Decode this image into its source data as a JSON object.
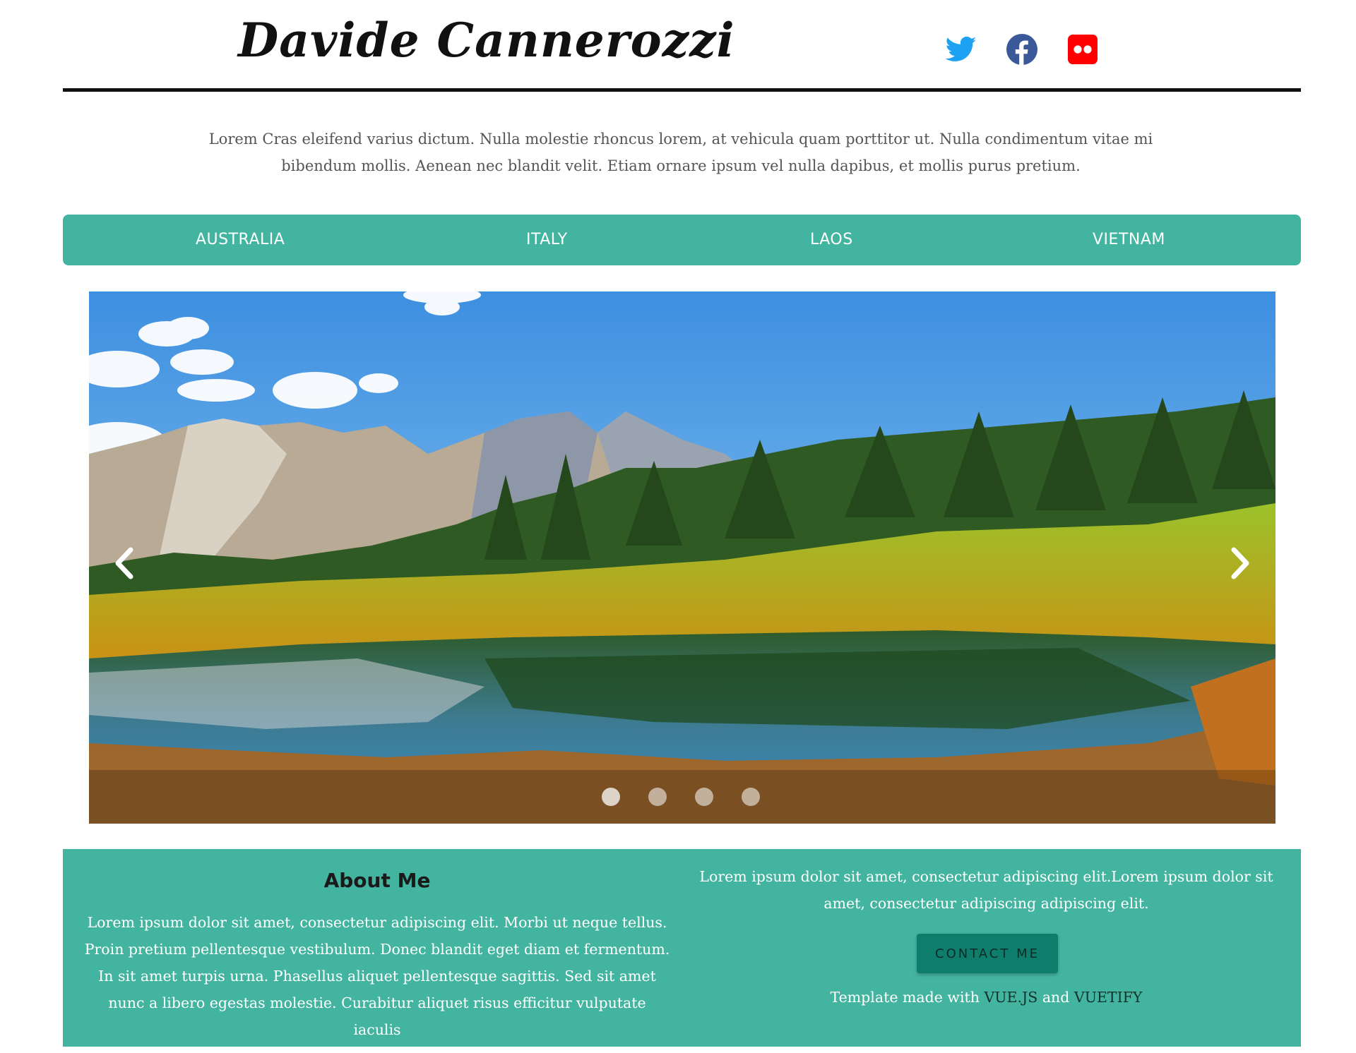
{
  "header": {
    "logo_text": "Davide Cannerozzi",
    "socials": [
      {
        "name": "twitter",
        "icon": "twitter-icon",
        "color": "#1da1f2"
      },
      {
        "name": "facebook",
        "icon": "facebook-icon",
        "color": "#3b5998"
      },
      {
        "name": "flickr",
        "icon": "flickr-icon",
        "color": "#ff0000"
      }
    ]
  },
  "intro": {
    "text": "Lorem Cras eleifend varius dictum. Nulla molestie rhoncus lorem, at vehicula quam porttitor ut. Nulla condimentum vitae mi bibendum mollis. Aenean nec blandit velit. Etiam ornare ipsum vel nulla dapibus, et mollis purus pretium."
  },
  "nav": {
    "items": [
      {
        "label": "AUSTRALIA"
      },
      {
        "label": "ITALY"
      },
      {
        "label": "LAOS"
      },
      {
        "label": "VIETNAM"
      }
    ],
    "color": "#42b49f"
  },
  "carousel": {
    "slide_count": 4,
    "active_index": 0
  },
  "footer": {
    "about_title": "About Me",
    "about_text": "Lorem ipsum dolor sit amet, consectetur adipiscing elit. Morbi ut neque tellus. Proin pretium pellentesque vestibulum. Donec blandit eget diam et fermentum. In sit amet turpis urna. Phasellus aliquet pellentesque sagittis. Sed sit amet nunc a libero egestas molestie. Curabitur aliquet risus efficitur vulputate iaculis",
    "right_text": "Lorem ipsum dolor sit amet, consectetur adipiscing elit.Lorem ipsum dolor sit amet, consectetur adipiscing adipiscing elit.",
    "contact_label": "CONTACT ME",
    "credit_prefix": "Template made with ",
    "credit_link1": "VUE.JS",
    "credit_and": " and ",
    "credit_link2": "VUETIFY",
    "color": "#42b49f"
  }
}
